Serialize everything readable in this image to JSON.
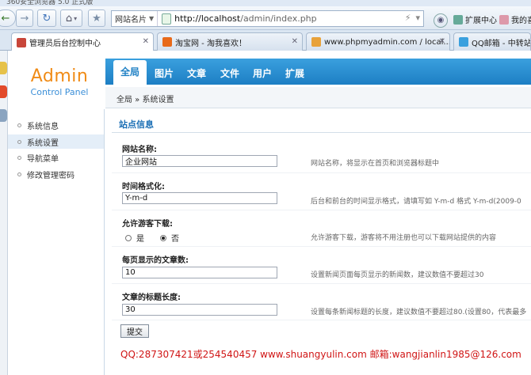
{
  "browser": {
    "title_fragment": "360安全浏览器 5.0 正式版",
    "site_selector": "网站名片",
    "url_host": "http://localhost",
    "url_path": "/admin/index.php",
    "ext_label": "扩展中心",
    "more_label": "我的喜欢"
  },
  "tabs": [
    {
      "label": "管理员后台控制中心",
      "color": "#c8463a"
    },
    {
      "label": "淘宝网 - 淘我喜欢！",
      "color": "#e86a1a"
    },
    {
      "label": "www.phpmyadmin.com / local...",
      "color": "#e8a23a"
    },
    {
      "label": "QQ邮箱 - 中转站",
      "color": "#3aa0de"
    }
  ],
  "admin": {
    "logo_title": "Admin",
    "logo_subtitle": "Control Panel",
    "nav": [
      "全局",
      "图片",
      "文章",
      "文件",
      "用户",
      "扩展"
    ],
    "breadcrumb": "全局 » 系统设置",
    "accent_color": "#1d7fc4"
  },
  "sidebar": {
    "items": [
      "系统信息",
      "系统设置",
      "导航菜单",
      "修改管理密码"
    ],
    "active_index": 1
  },
  "form": {
    "section_title": "站点信息",
    "site_name": {
      "label": "网站名称:",
      "value": "企业网站",
      "hint": "网站名称，将显示在首页和浏览器标题中"
    },
    "time_format": {
      "label": "时间格式化:",
      "value": "Y-m-d",
      "hint": "后台和前台的时间显示格式，请填写如 Y-m-d 格式 Y-m-d(2009-0"
    },
    "allow_guest": {
      "label": "允许游客下载:",
      "yes": "是",
      "no": "否",
      "selected": "否",
      "hint": "允许游客下载，游客将不用注册也可以下载网站提供的内容"
    },
    "per_page": {
      "label": "每页显示的文章数:",
      "value": "10",
      "hint": "设置新闻页面每页显示的新闻数，建议数值不要超过30"
    },
    "title_length": {
      "label": "文章的标题长度:",
      "value": "30",
      "hint": "设置每条新闻标题的长度，建议数值不要超过80.(设置80，代表最多"
    },
    "submit": "提交"
  },
  "footer": "QQ:287307421或254540457 www.shuangyulin.com 邮箱:wangjianlin1985@126.com"
}
